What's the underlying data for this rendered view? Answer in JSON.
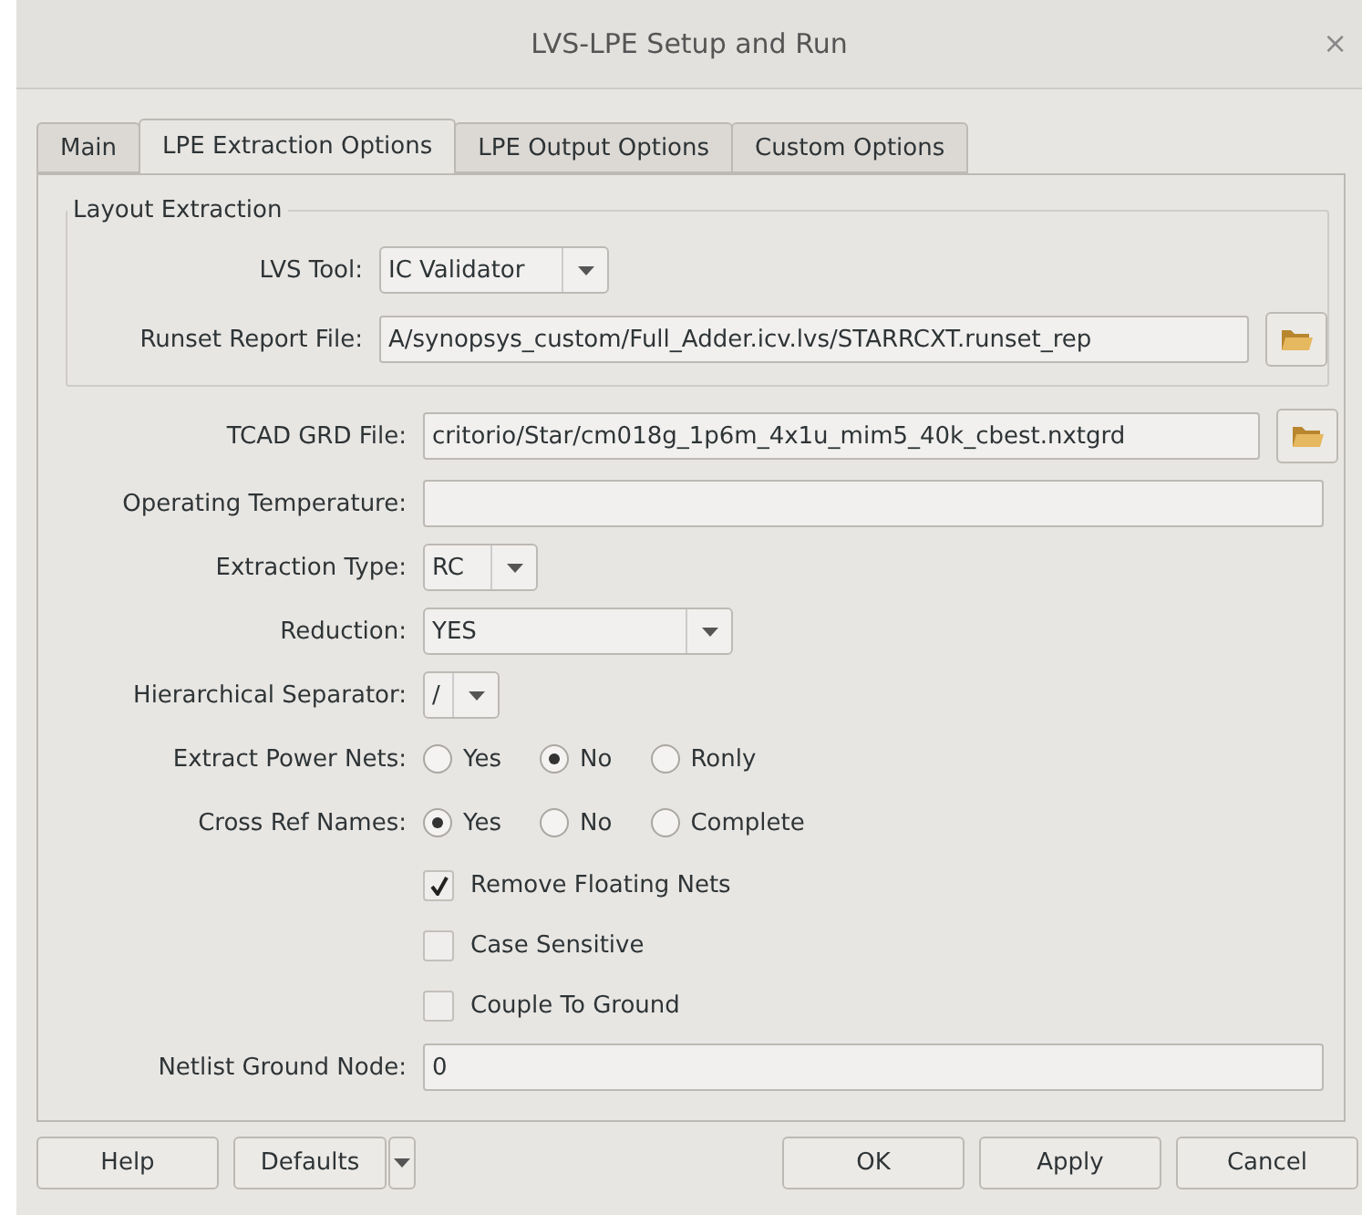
{
  "window": {
    "title": "LVS-LPE Setup and Run",
    "close": "×"
  },
  "tabs": [
    {
      "label": "Main",
      "selected": false
    },
    {
      "label": "LPE Extraction Options",
      "selected": true
    },
    {
      "label": "LPE Output Options",
      "selected": false
    },
    {
      "label": "Custom Options",
      "selected": false
    }
  ],
  "group": {
    "title": "Layout Extraction",
    "fields": [
      {
        "kind": "combo",
        "label": "LVS Tool:",
        "value": "IC Validator"
      },
      {
        "kind": "file",
        "label": "Runset Report File:",
        "value": "A/synopsys_custom/Full_Adder.icv.lvs/STARRCXT.runset_rep"
      }
    ]
  },
  "fields": [
    {
      "kind": "file",
      "label": "TCAD GRD File:",
      "value": "critorio/Star/cm018g_1p6m_4x1u_mim5_40k_cbest.nxtgrd"
    },
    {
      "kind": "text",
      "label": "Operating Temperature:"
    },
    {
      "kind": "combo",
      "label": "Extraction Type:",
      "value": "RC"
    },
    {
      "kind": "combo",
      "label": "Reduction:",
      "value": "YES"
    },
    {
      "kind": "combo",
      "label": "Hierarchical Separator:",
      "value": "/"
    },
    {
      "kind": "radio",
      "label": "Extract Power Nets:",
      "options": [
        {
          "label": "Yes",
          "selected": false
        },
        {
          "label": "No",
          "selected": true
        },
        {
          "label": "Ronly",
          "selected": false
        }
      ]
    },
    {
      "kind": "radio",
      "label": "Cross Ref Names:",
      "options": [
        {
          "label": "Yes",
          "selected": true
        },
        {
          "label": "No",
          "selected": false
        },
        {
          "label": "Complete",
          "selected": false
        }
      ]
    },
    {
      "kind": "checkbox",
      "label": "Remove Floating Nets",
      "checked": true
    },
    {
      "kind": "checkbox",
      "label": "Case Sensitive",
      "checked": false
    },
    {
      "kind": "checkbox",
      "label": "Couple To Ground",
      "checked": false
    },
    {
      "kind": "text",
      "label": "Netlist Ground Node:",
      "value": "0"
    }
  ],
  "buttons": {
    "left": [
      "Help",
      "Defaults"
    ],
    "right": [
      "OK",
      "Apply",
      "Cancel"
    ]
  }
}
